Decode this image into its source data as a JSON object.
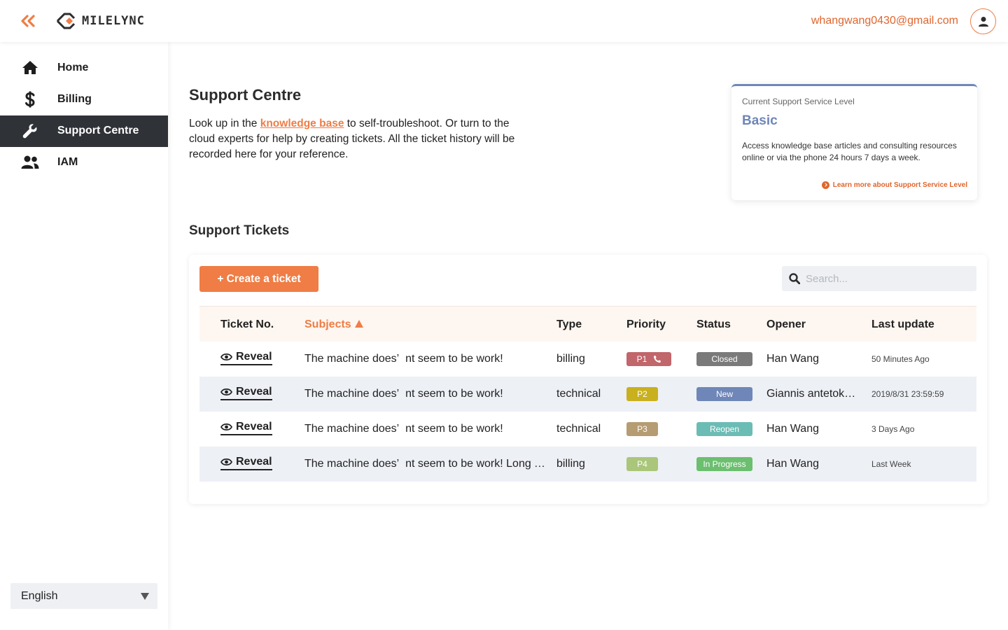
{
  "header": {
    "brand": "MILELYNC",
    "user_email": "whangwang0430@gmail.com",
    "colors": {
      "accent": "#ef7d45",
      "dark": "#2f3237"
    }
  },
  "sidebar": {
    "items": [
      {
        "label": "Home",
        "icon": "home-icon",
        "active": false
      },
      {
        "label": "Billing",
        "icon": "dollar-icon",
        "active": false
      },
      {
        "label": "Support Centre",
        "icon": "wrench-icon",
        "active": true
      },
      {
        "label": "IAM",
        "icon": "users-icon",
        "active": false
      }
    ],
    "language": "English"
  },
  "main": {
    "title": "Support Centre",
    "intro_before": "Look up in the ",
    "intro_link": "knowledge base",
    "intro_after": " to self-troubleshoot. Or turn to the cloud experts for help by creating tickets. All the ticket history will be recorded here for your reference."
  },
  "service_level": {
    "caption": "Current Support Service Level",
    "level": "Basic",
    "description": "Access knowledge base articles and consulting resources online or via the phone 24 hours 7 days a week.",
    "link": "Learn more about Support Service Level"
  },
  "tickets": {
    "title": "Support Tickets",
    "create_label": "+ Create a ticket",
    "search_placeholder": "Search...",
    "columns": {
      "ticket_no": "Ticket No.",
      "subjects": "Subjects",
      "type": "Type",
      "priority": "Priority",
      "status": "Status",
      "opener": "Opener",
      "last_update": "Last update"
    },
    "rows": [
      {
        "reveal": "Reveal",
        "subject": "The machine does’  nt seem to be work!",
        "type": "billing",
        "priority": "P1",
        "priority_color": "#c1666b",
        "phone": true,
        "status": "Closed",
        "status_color": "#7a7a7a",
        "opener": "Han Wang",
        "updated": "50 Minutes Ago"
      },
      {
        "reveal": "Reveal",
        "subject": "The machine does’  nt seem to be work!",
        "type": "technical",
        "priority": "P2",
        "priority_color": "#c9b01e",
        "phone": false,
        "status": "New",
        "status_color": "#6f86b8",
        "opener": "Giannis antetokounmpo",
        "updated": "2019/8/31 23:59:59"
      },
      {
        "reveal": "Reveal",
        "subject": "The machine does’  nt seem to be work!",
        "type": "technical",
        "priority": "P3",
        "priority_color": "#b59c72",
        "phone": false,
        "status": "Reopen",
        "status_color": "#6bbcb5",
        "opener": "Han Wang",
        "updated": "3 Days Ago"
      },
      {
        "reveal": "Reveal",
        "subject": "The machine does’  nt seem to be work! Long Title Long Title",
        "type": "billing",
        "priority": "P4",
        "priority_color": "#a9c67a",
        "phone": false,
        "status": "In Progress",
        "status_color": "#6bbf6f",
        "opener": "Han Wang",
        "updated": "Last Week"
      }
    ]
  }
}
